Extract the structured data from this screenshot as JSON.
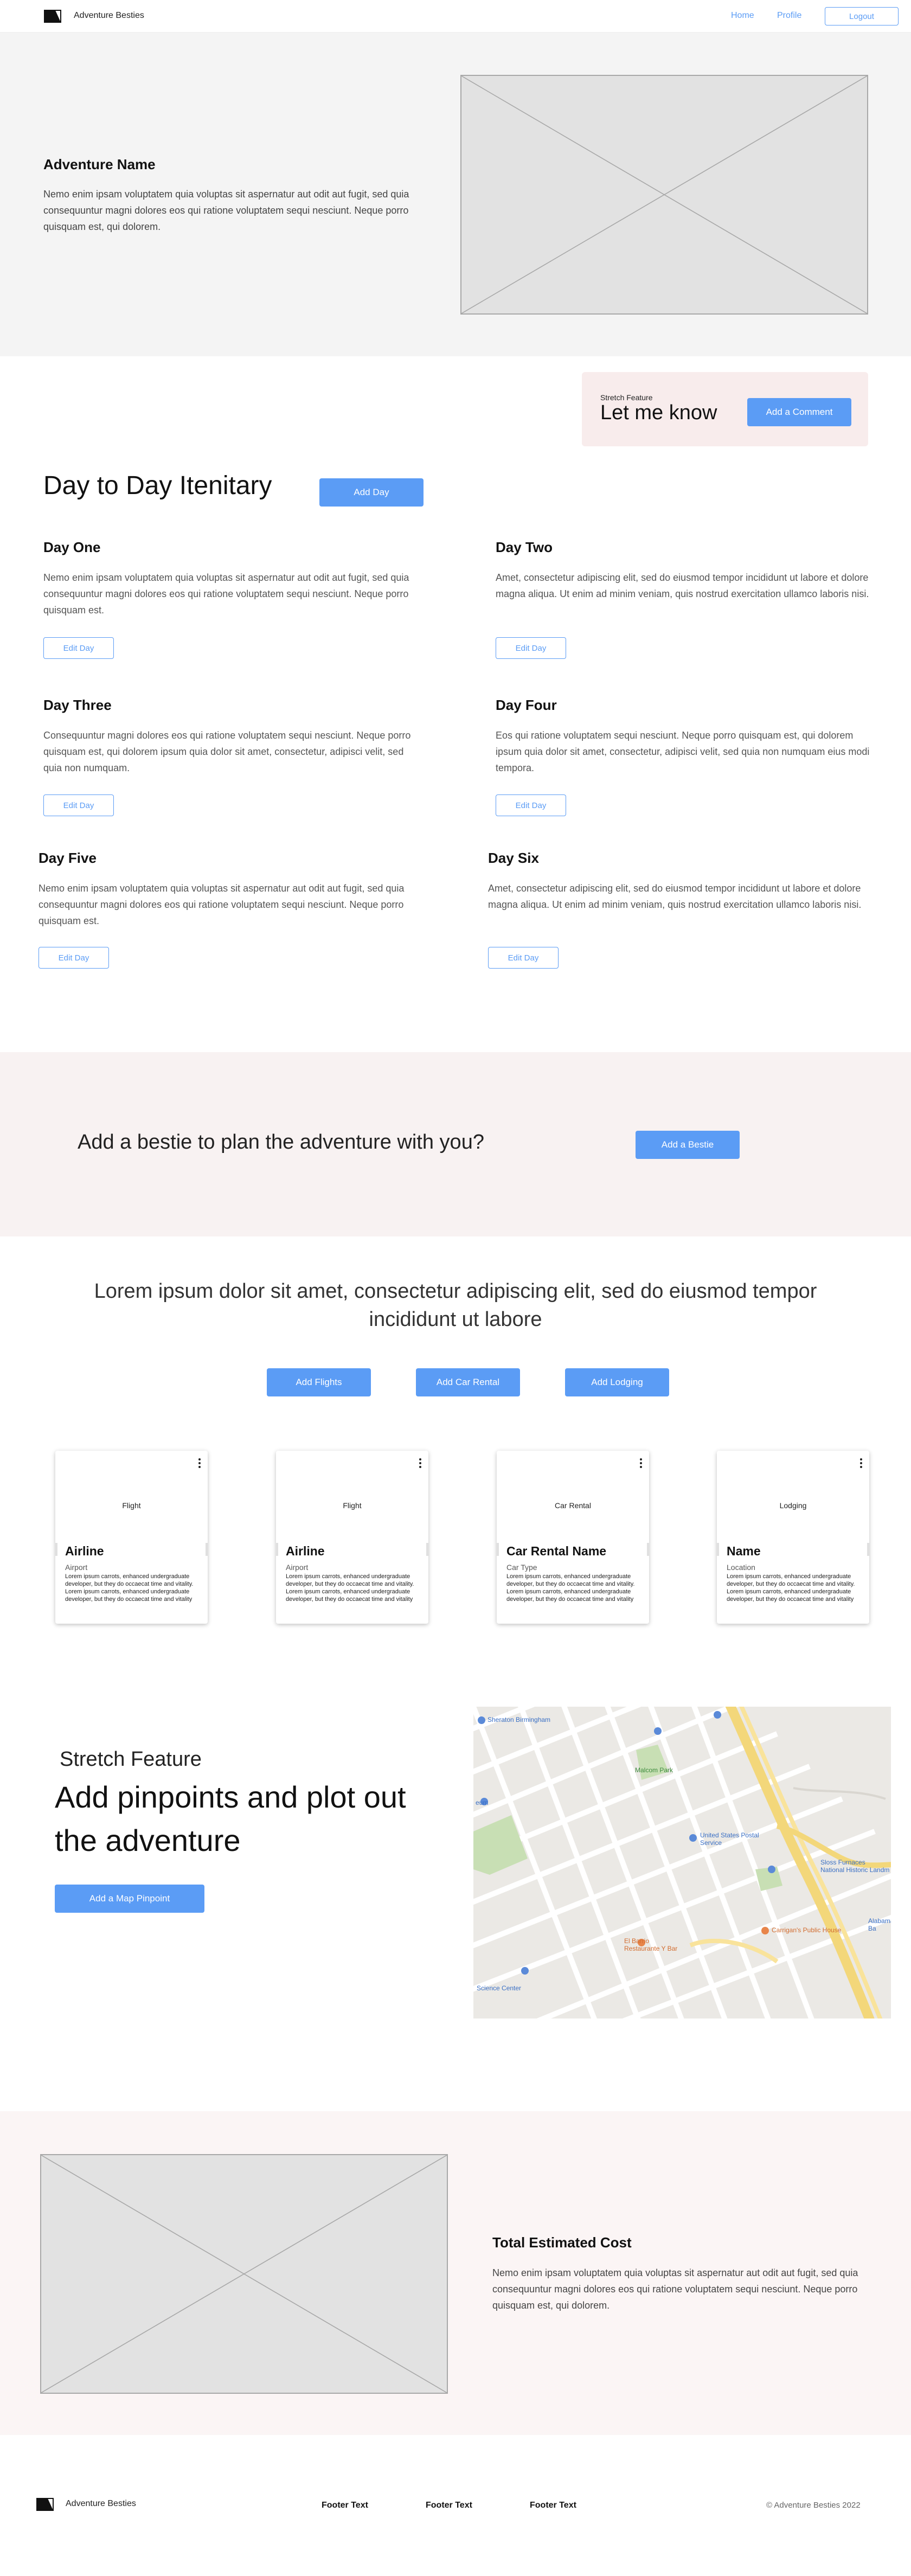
{
  "nav": {
    "brand": "Adventure Besties",
    "links": [
      "Home",
      "Profile"
    ],
    "logout": "Logout",
    "link_color": "#5b9cf5"
  },
  "hero": {
    "title": "Adventure Name",
    "description": "Nemo enim ipsam voluptatem quia voluptas sit aspernatur aut odit aut fugit, sed quia consequuntur magni dolores eos qui ratione voluptatem sequi nesciunt. Neque porro quisquam est, qui dolorem."
  },
  "stretch_comment": {
    "label": "Stretch Feature",
    "title": "Let me know",
    "button": "Add a Comment"
  },
  "itinerary": {
    "title": "Day to Day Itenitary",
    "add_button": "Add Day",
    "days": [
      {
        "title": "Day One",
        "description": "Nemo enim ipsam voluptatem quia voluptas sit aspernatur aut odit aut fugit, sed quia consequuntur magni dolores eos qui ratione voluptatem sequi nesciunt. Neque porro quisquam est.",
        "edit": "Edit Day"
      },
      {
        "title": "Day Two",
        "description": "Amet, consectetur adipiscing elit, sed do eiusmod tempor incididunt ut labore et dolore magna aliqua. Ut enim ad minim veniam, quis nostrud exercitation ullamco laboris nisi.",
        "edit": "Edit Day"
      },
      {
        "title": "Day Three",
        "description": "Consequuntur magni dolores eos qui ratione voluptatem sequi nesciunt. Neque porro quisquam est, qui dolorem ipsum quia dolor sit amet, consectetur, adipisci velit, sed quia non numquam.",
        "edit": "Edit Day"
      },
      {
        "title": "Day Four",
        "description": "Eos qui ratione voluptatem sequi nesciunt. Neque porro quisquam est, qui dolorem ipsum quia dolor sit amet, consectetur, adipisci velit, sed quia non numquam eius modi tempora.",
        "edit": "Edit Day"
      },
      {
        "title": "Day Five",
        "description": "Nemo enim ipsam voluptatem quia voluptas sit aspernatur aut odit aut fugit, sed quia consequuntur magni dolores eos qui ratione voluptatem sequi nesciunt. Neque porro quisquam est.",
        "edit": "Edit Day"
      },
      {
        "title": "Day Six",
        "description": "Amet, consectetur adipiscing elit, sed do eiusmod tempor incididunt ut labore et dolore magna aliqua. Ut enim ad minim veniam, quis nostrud exercitation ullamco laboris nisi.",
        "edit": "Edit Day"
      }
    ]
  },
  "bestie": {
    "text": "Add a bestie to plan the adventure with you?",
    "button": "Add a Bestie"
  },
  "bookings": {
    "heading": "Lorem ipsum dolor sit amet, consectetur adipiscing elit, sed do eiusmod tempor incididunt ut labore",
    "buttons": [
      "Add Flights",
      "Add Car Rental",
      "Add Lodging"
    ],
    "cards": [
      {
        "media": "Flight",
        "title": "Airline",
        "subtitle": "Airport",
        "body": "Lorem ipsum carrots, enhanced undergraduate developer, but they do occaecat time and vitality. Lorem ipsum carrots, enhanced undergraduate developer, but they do occaecat time and vitality"
      },
      {
        "media": "Flight",
        "title": "Airline",
        "subtitle": "Airport",
        "body": "Lorem ipsum carrots, enhanced undergraduate developer, but they do occaecat time and vitality. Lorem ipsum carrots, enhanced undergraduate developer, but they do occaecat time and vitality"
      },
      {
        "media": "Car Rental",
        "title": "Car Rental Name",
        "subtitle": "Car Type",
        "body": "Lorem ipsum carrots, enhanced undergraduate developer, but they do occaecat time and vitality. Lorem ipsum carrots, enhanced undergraduate developer, but they do occaecat time and vitality"
      },
      {
        "media": "Lodging",
        "title": "Name",
        "subtitle": "Location",
        "body": "Lorem ipsum carrots, enhanced undergraduate developer, but they do occaecat time and vitality. Lorem ipsum carrots, enhanced undergraduate developer, but they do occaecat time and vitality"
      }
    ]
  },
  "map_section": {
    "label": "Stretch Feature",
    "title": "Add pinpoints and plot out the adventure",
    "button": "Add a Map Pinpoint",
    "map_labels": [
      "Sheraton Birmingham",
      "Malcom Park",
      "United States Postal Service",
      "Sloss Furnaces National Historic Landm",
      "Alabama Ba",
      "El Barrio Restaurante Y Bar",
      "Carrigan's Public House",
      "Science Center",
      "eum"
    ]
  },
  "cost": {
    "title": "Total Estimated Cost",
    "description": "Nemo enim ipsam voluptatem quia voluptas sit aspernatur aut odit aut fugit, sed quia consequuntur magni dolores eos qui ratione voluptatem sequi nesciunt. Neque porro quisquam est, qui dolorem."
  },
  "footer": {
    "brand": "Adventure Besties",
    "texts": [
      "Footer Text",
      "Footer Text",
      "Footer Text"
    ],
    "copyright": "© Adventure Besties 2022"
  }
}
